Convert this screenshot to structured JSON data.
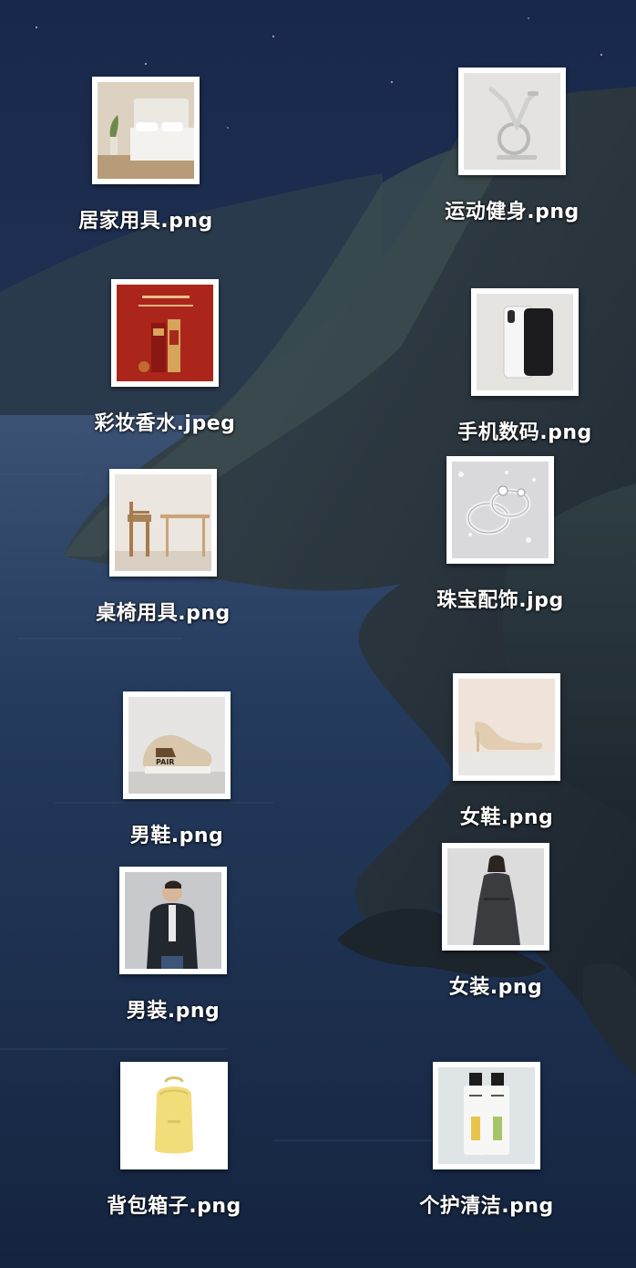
{
  "desktop": {
    "wallpaper": {
      "sky_color": "#1d2d4e",
      "sea_color": "#1a2c48",
      "cliff_color": "#2a3340"
    },
    "icons": [
      {
        "label": "居家用具.png",
        "icon": "bed-thumbnail-icon"
      },
      {
        "label": "运动健身.png",
        "icon": "exercise-bike-thumbnail-icon"
      },
      {
        "label": "彩妆香水.jpeg",
        "icon": "lipstick-thumbnail-icon"
      },
      {
        "label": "手机数码.png",
        "icon": "smartphone-thumbnail-icon"
      },
      {
        "label": "桌椅用具.png",
        "icon": "table-chair-thumbnail-icon"
      },
      {
        "label": "珠宝配饰.jpg",
        "icon": "rings-thumbnail-icon"
      },
      {
        "label": "男鞋.png",
        "icon": "sneaker-thumbnail-icon"
      },
      {
        "label": "女鞋.png",
        "icon": "high-heel-thumbnail-icon"
      },
      {
        "label": "男装.png",
        "icon": "menswear-thumbnail-icon"
      },
      {
        "label": "女装.png",
        "icon": "dress-thumbnail-icon"
      },
      {
        "label": "背包箱子.png",
        "icon": "backpack-thumbnail-icon"
      },
      {
        "label": "个护清洁.png",
        "icon": "lotion-bottles-thumbnail-icon"
      }
    ]
  }
}
